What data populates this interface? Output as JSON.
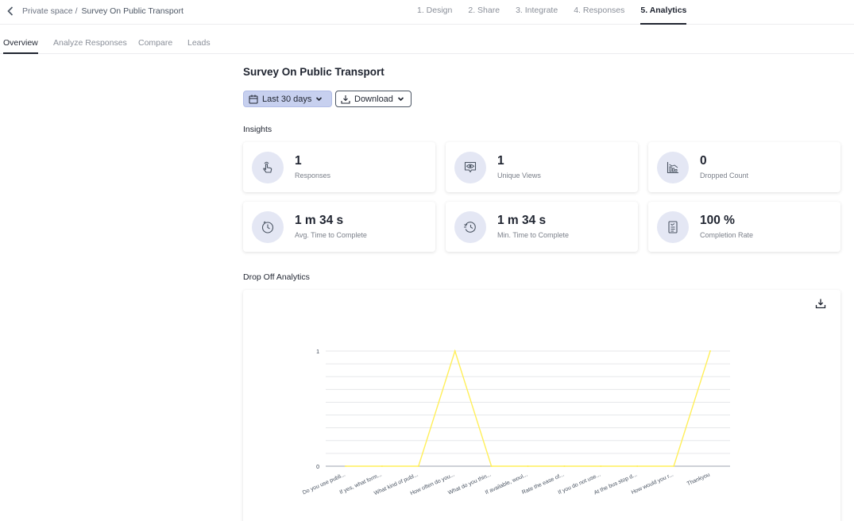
{
  "breadcrumb": {
    "parent": "Private space",
    "separator": "/",
    "current": "Survey On Public Transport"
  },
  "steps": [
    "1. Design",
    "2. Share",
    "3. Integrate",
    "4. Responses",
    "5. Analytics"
  ],
  "active_step": "5. Analytics",
  "subtabs": [
    "Overview",
    "Analyze Responses",
    "Compare",
    "Leads"
  ],
  "active_subtab": "Overview",
  "page_title": "Survey On Public Transport",
  "filters": {
    "date_range": "Last 30 days",
    "download": "Download"
  },
  "insights": {
    "heading": "Insights",
    "cards": [
      {
        "value": "1",
        "label": "Responses",
        "icon": "hand-pointer-icon"
      },
      {
        "value": "1",
        "label": "Unique Views",
        "icon": "eye-chat-icon"
      },
      {
        "value": "0",
        "label": "Dropped Count",
        "icon": "bar-chart-icon"
      },
      {
        "value": "1 m 34 s",
        "label": "Avg. Time to Complete",
        "icon": "clock-icon"
      },
      {
        "value": "1 m 34 s",
        "label": "Min. Time to Complete",
        "icon": "history-clock-icon"
      },
      {
        "value": "100 %",
        "label": "Completion Rate",
        "icon": "checklist-document-icon"
      }
    ]
  },
  "drop_off": {
    "heading": "Drop Off Analytics"
  },
  "colors": {
    "accent": "#c7d0ef",
    "line": "#ffef5a",
    "icon": "#4b5563"
  },
  "chart_data": {
    "type": "line",
    "title": "",
    "xlabel": "",
    "ylabel": "",
    "categories": [
      "Do you use publi...",
      "If yes, what form...",
      "What kind of publ...",
      "How often do you...",
      "What do you thin...",
      "If available, woul...",
      "Rate the ease of...",
      "If you do not use...",
      "At the bus stop d...",
      "How would you r...",
      "Thankyou"
    ],
    "series": [
      {
        "values": [
          0,
          0,
          0,
          1,
          0,
          0,
          0,
          0,
          0,
          0,
          1
        ]
      }
    ],
    "ylim": [
      0,
      1
    ],
    "yticks": [
      "0",
      "1"
    ],
    "grid": true
  }
}
